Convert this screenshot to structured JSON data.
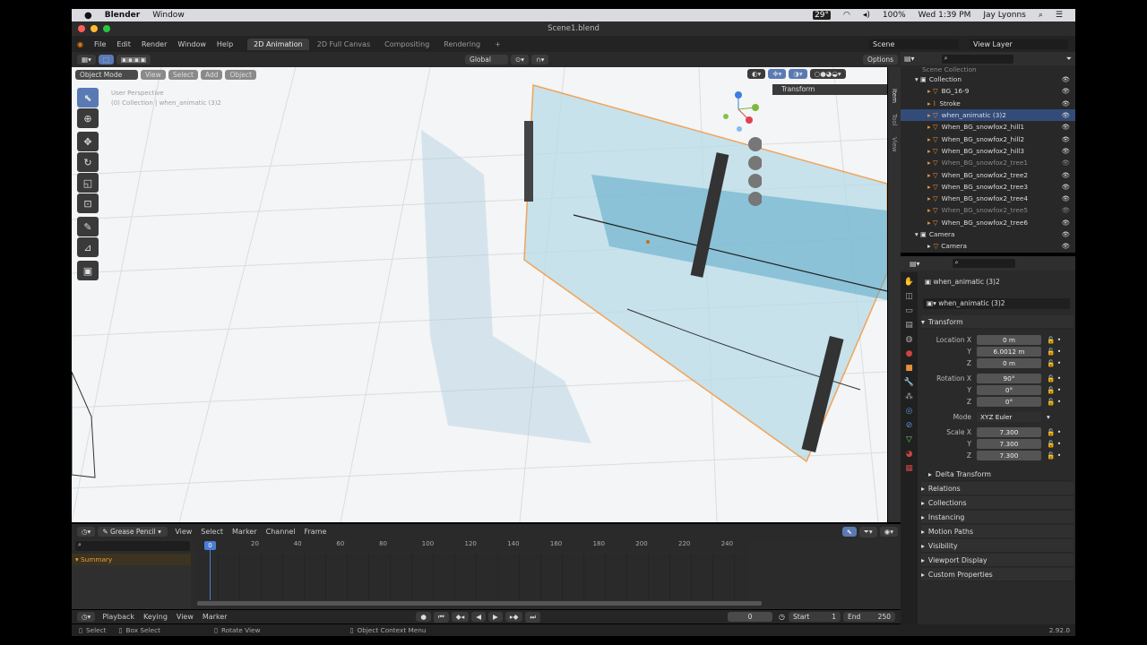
{
  "mac": {
    "app": "Blender",
    "window": "Window",
    "battery": "100%",
    "clock": "Wed 1:39 PM",
    "user": "Jay Lyonns",
    "temp": "29°"
  },
  "title": "Scene1.blend",
  "menu": [
    "File",
    "Edit",
    "Render",
    "Window",
    "Help"
  ],
  "workspaces": [
    "2D Animation",
    "2D Full Canvas",
    "Compositing",
    "Rendering"
  ],
  "scene": "Scene",
  "view_layer": "View Layer",
  "transform_orient": "Global",
  "options": "Options",
  "mode": "Object Mode",
  "vp_menus": [
    "View",
    "Select",
    "Add",
    "Object"
  ],
  "overlay": {
    "line1": "User Perspective",
    "line2": "(0) Collection | when_animatic (3)2"
  },
  "npanel": {
    "tabs": [
      "Item",
      "Tool",
      "View"
    ],
    "section": "Transform"
  },
  "outliner": {
    "top": "Scene Collection",
    "collection": "Collection",
    "items": [
      "BG_16-9",
      "Stroke",
      "when_animatic (3)2",
      "When_BG_snowfox2_hill1",
      "When_BG_snowfox2_hill2",
      "When_BG_snowfox2_hill3",
      "When_BG_snowfox2_tree1",
      "When_BG_snowfox2_tree2",
      "When_BG_snowfox2_tree3",
      "When_BG_snowfox2_tree4",
      "When_BG_snowfox2_tree5",
      "When_BG_snowfox2_tree6"
    ],
    "camera_col": "Camera",
    "camera": "Camera"
  },
  "props": {
    "object": "when_animatic (3)2",
    "datablock": "when_animatic (3)2",
    "transform": "Transform",
    "location_label": "Location X",
    "loc": [
      "0 m",
      "6.0012 m",
      "0 m"
    ],
    "rotation_label": "Rotation X",
    "rot": [
      "90°",
      "0°",
      "0°"
    ],
    "mode_label": "Mode",
    "mode": "XYZ Euler",
    "scale_label": "Scale X",
    "scale": [
      "7.300",
      "7.300",
      "7.300"
    ],
    "y": "Y",
    "z": "Z",
    "sections": [
      "Delta Transform",
      "Relations",
      "Collections",
      "Instancing",
      "Motion Paths",
      "Visibility",
      "Viewport Display",
      "Custom Properties"
    ]
  },
  "dope": {
    "editor": "Grease Pencil",
    "menus": [
      "View",
      "Select",
      "Marker",
      "Channel",
      "Frame"
    ],
    "summary": "Summary",
    "frames": [
      "0",
      "20",
      "40",
      "60",
      "80",
      "100",
      "120",
      "140",
      "160",
      "180",
      "200",
      "220",
      "240"
    ]
  },
  "playback": {
    "menus": [
      "Playback",
      "Keying",
      "View",
      "Marker"
    ],
    "frame": "0",
    "start_label": "Start",
    "start": "1",
    "end_label": "End",
    "end": "250"
  },
  "status": {
    "select": "Select",
    "box": "Box Select",
    "rotate": "Rotate View",
    "context": "Object Context Menu",
    "version": "2.92.0"
  }
}
